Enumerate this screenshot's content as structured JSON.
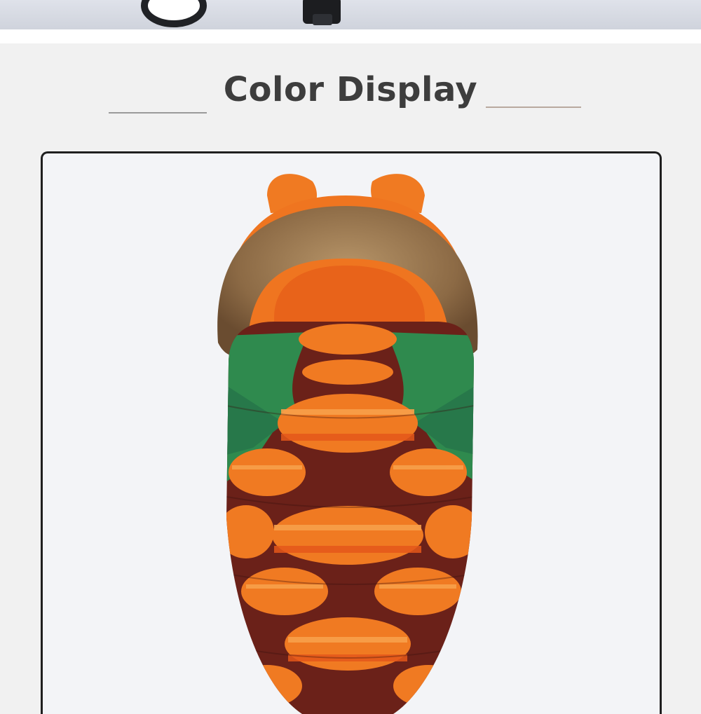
{
  "header": {
    "title": "Color Display"
  },
  "icons": {
    "stroller_wheels": "stroller-wheels-image",
    "product": "sleeping-bag-photo"
  },
  "colors": {
    "title": "#3d3d3d",
    "frame_border": "#1f1f1f",
    "orange": "#f07a22",
    "green": "#2f8a4e",
    "maroon": "#6b2119",
    "fur": "#9a7a54"
  }
}
